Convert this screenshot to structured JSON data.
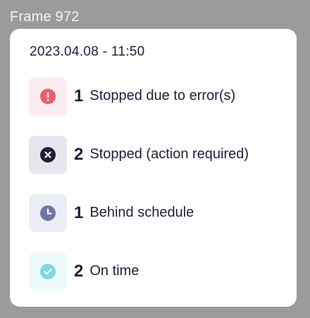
{
  "frame_label": "Frame 972",
  "popup": {
    "timestamp": "2023.04.08 - 11:50",
    "rows": [
      {
        "icon": "error-icon",
        "count": "1",
        "label": "Stopped due to error(s)",
        "box_color": "#fdecef",
        "icon_color": "#ec5b74"
      },
      {
        "icon": "stopped-icon",
        "count": "2",
        "label": "Stopped (action required)",
        "box_color": "#e6e7ee",
        "icon_color": "#1f1f3a"
      },
      {
        "icon": "clock-icon",
        "count": "1",
        "label": "Behind schedule",
        "box_color": "#eceef5",
        "icon_color": "#7076a3"
      },
      {
        "icon": "check-icon",
        "count": "2",
        "label": "On time",
        "box_color": "#edfafc",
        "icon_color": "#7dd9e0"
      }
    ]
  }
}
